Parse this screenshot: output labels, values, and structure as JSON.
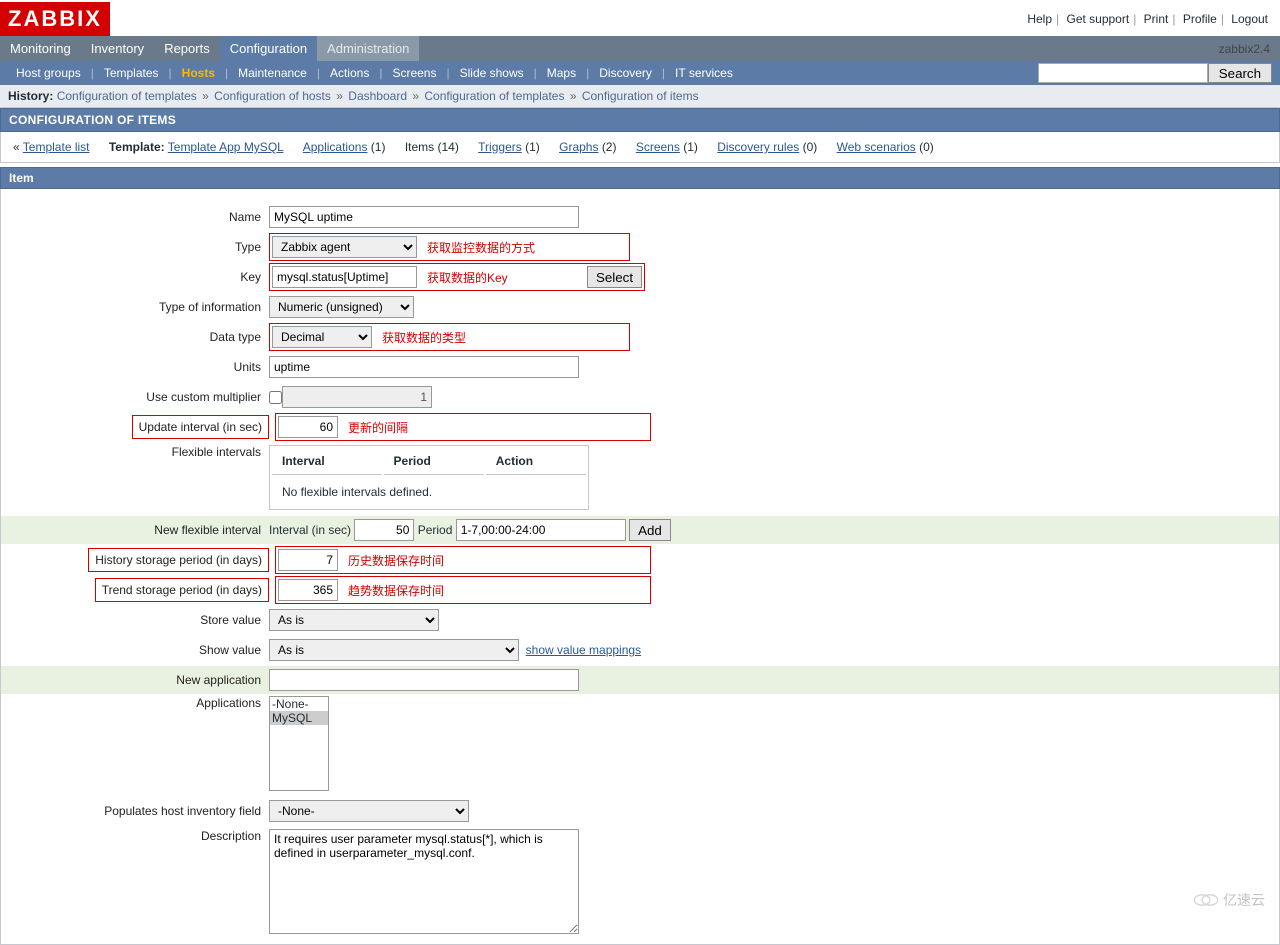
{
  "brand": "ZABBIX",
  "top_links": {
    "help": "Help",
    "support": "Get support",
    "print": "Print",
    "profile": "Profile",
    "logout": "Logout"
  },
  "version": "zabbix2.4",
  "menu1": {
    "monitoring": "Monitoring",
    "inventory": "Inventory",
    "reports": "Reports",
    "configuration": "Configuration",
    "administration": "Administration"
  },
  "menu2": {
    "host_groups": "Host groups",
    "templates": "Templates",
    "hosts": "Hosts",
    "maintenance": "Maintenance",
    "actions": "Actions",
    "screens": "Screens",
    "slide_shows": "Slide shows",
    "maps": "Maps",
    "discovery": "Discovery",
    "it_services": "IT services",
    "search_btn": "Search"
  },
  "history": {
    "label": "History:",
    "crumbs": [
      "Configuration of templates",
      "Configuration of hosts",
      "Dashboard",
      "Configuration of templates",
      "Configuration of items"
    ]
  },
  "bar_title": "CONFIGURATION OF ITEMS",
  "nav": {
    "back": "« ",
    "template_list": "Template list",
    "template_lbl": "Template:",
    "template_name": "Template App MySQL",
    "applications": "Applications",
    "applications_count": "(1)",
    "items": "Items (14)",
    "triggers": "Triggers",
    "triggers_count": "(1)",
    "graphs": "Graphs",
    "graphs_count": "(2)",
    "screens": "Screens",
    "screens_count": "(1)",
    "discovery": "Discovery rules",
    "discovery_count": "(0)",
    "scenarios": "Web scenarios",
    "scenarios_count": "(0)"
  },
  "section": "Item",
  "form": {
    "name_lbl": "Name",
    "name_val": "MySQL uptime",
    "type_lbl": "Type",
    "type_val": "Zabbix agent",
    "type_annot": "获取监控数据的方式",
    "key_lbl": "Key",
    "key_val": "mysql.status[Uptime]",
    "key_annot": "获取数据的Key",
    "key_btn": "Select",
    "toi_lbl": "Type of information",
    "toi_val": "Numeric (unsigned)",
    "dt_lbl": "Data type",
    "dt_val": "Decimal",
    "dt_annot": "获取数据的类型",
    "units_lbl": "Units",
    "units_val": "uptime",
    "mult_lbl": "Use custom multiplier",
    "mult_val": "1",
    "upd_lbl": "Update interval (in sec)",
    "upd_val": "60",
    "upd_annot": "更新的间隔",
    "flex_lbl": "Flexible intervals",
    "flex_h1": "Interval",
    "flex_h2": "Period",
    "flex_h3": "Action",
    "flex_empty": "No flexible intervals defined.",
    "newflex_lbl": "New flexible interval",
    "newflex_int_lbl": "Interval (in sec)",
    "newflex_int_val": "50",
    "newflex_per_lbl": "Period",
    "newflex_per_val": "1-7,00:00-24:00",
    "newflex_btn": "Add",
    "hist_lbl": "History storage period (in days)",
    "hist_val": "7",
    "hist_annot": "历史数据保存时间",
    "trend_lbl": "Trend storage period (in days)",
    "trend_val": "365",
    "trend_annot": "趋势数据保存时间",
    "store_lbl": "Store value",
    "store_val": "As is",
    "show_lbl": "Show value",
    "show_val": "As is",
    "show_link": "show value mappings",
    "newapp_lbl": "New application",
    "apps_lbl": "Applications",
    "apps_opt1": "-None-",
    "apps_opt2": "MySQL",
    "inv_lbl": "Populates host inventory field",
    "inv_val": "-None-",
    "desc_lbl": "Description",
    "desc_val": "It requires user parameter mysql.status[*], which is defined in userparameter_mysql.conf."
  },
  "watermark": "亿速云"
}
